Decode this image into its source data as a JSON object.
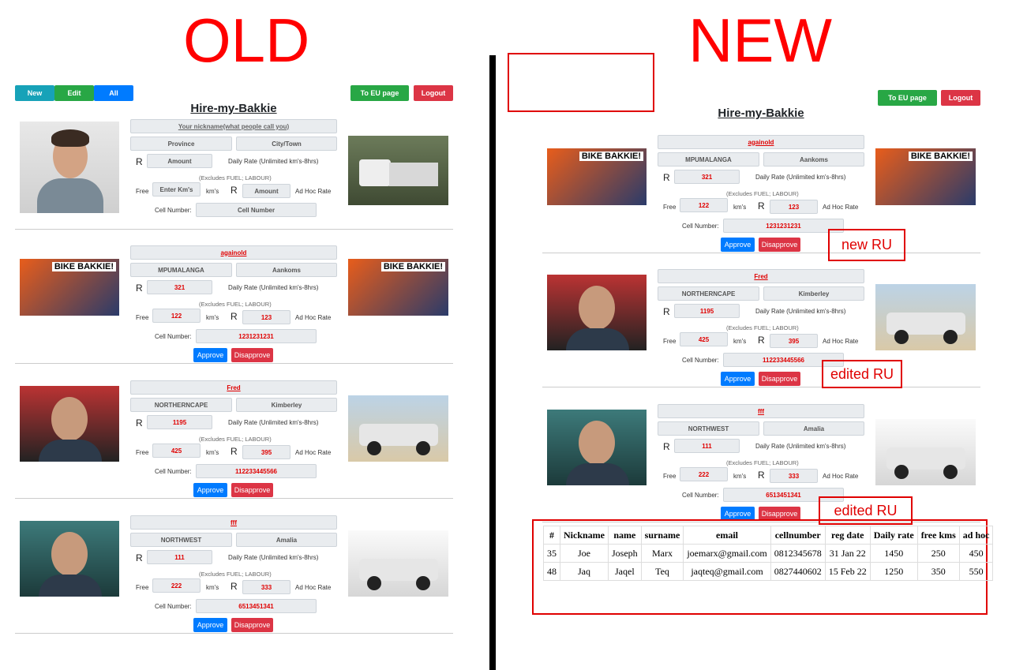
{
  "headings": {
    "old": "OLD",
    "new": "NEW"
  },
  "brand": "Hire-my-Bakkie",
  "nav": {
    "new": "New",
    "edit": "Edit",
    "all": "All",
    "eu": "To EU page",
    "logout": "Logout"
  },
  "labels": {
    "rand": "R",
    "daily": "Daily Rate (Unlimited km's-8hrs)",
    "excl": "(Excludes FUEL; LABOUR)",
    "free": "Free",
    "kms": "km's",
    "adhoc": "Ad Hoc Rate",
    "cell": "Cell Number:",
    "approve": "Approve",
    "disapprove": "Disapprove"
  },
  "form": {
    "nickname": "Your nickname(what people call you)",
    "province": "Province",
    "city": "City/Town",
    "amount": "Amount",
    "kms": "Enter Km's",
    "adhoc": "Amount",
    "cell": "Cell Number"
  },
  "entries": [
    {
      "nickname": "againold",
      "province": "MPUMALANGA",
      "city": "Aankoms",
      "rate": "321",
      "free": "122",
      "adhoc": "123",
      "cell": "1231231231",
      "photo_label": "BIKE BAKKIE!",
      "car_label": "BIKE BAKKIE!"
    },
    {
      "nickname": "Fred",
      "province": "NORTHERNCAPE",
      "city": "Kimberley",
      "rate": "1195",
      "free": "425",
      "adhoc": "395",
      "cell": "112233445566"
    },
    {
      "nickname": "fff",
      "province": "NORTHWEST",
      "city": "Amalia",
      "rate": "111",
      "free": "222",
      "adhoc": "333",
      "cell": "6513451341"
    }
  ],
  "annotations": {
    "new_ru": "new RU",
    "edited1": "edited RU",
    "edited2": "edited RU"
  },
  "table": {
    "headers": [
      "#",
      "Nickname",
      "name",
      "surname",
      "email",
      "cellnumber",
      "reg date",
      "Daily rate",
      "free kms",
      "ad hoc"
    ],
    "rows": [
      [
        "35",
        "Joe",
        "Joseph",
        "Marx",
        "joemarx@gmail.com",
        "0812345678",
        "31 Jan 22",
        "1450",
        "250",
        "450"
      ],
      [
        "48",
        "Jaq",
        "Jaqel",
        "Teq",
        "jaqteq@gmail.com",
        "0827440602",
        "15 Feb 22",
        "1250",
        "350",
        "550"
      ]
    ]
  },
  "colors": {
    "accent_red": "#ff0000",
    "approve": "#007bff",
    "disapprove": "#dc3545",
    "eu": "#28a745",
    "new": "#17a2b8"
  }
}
